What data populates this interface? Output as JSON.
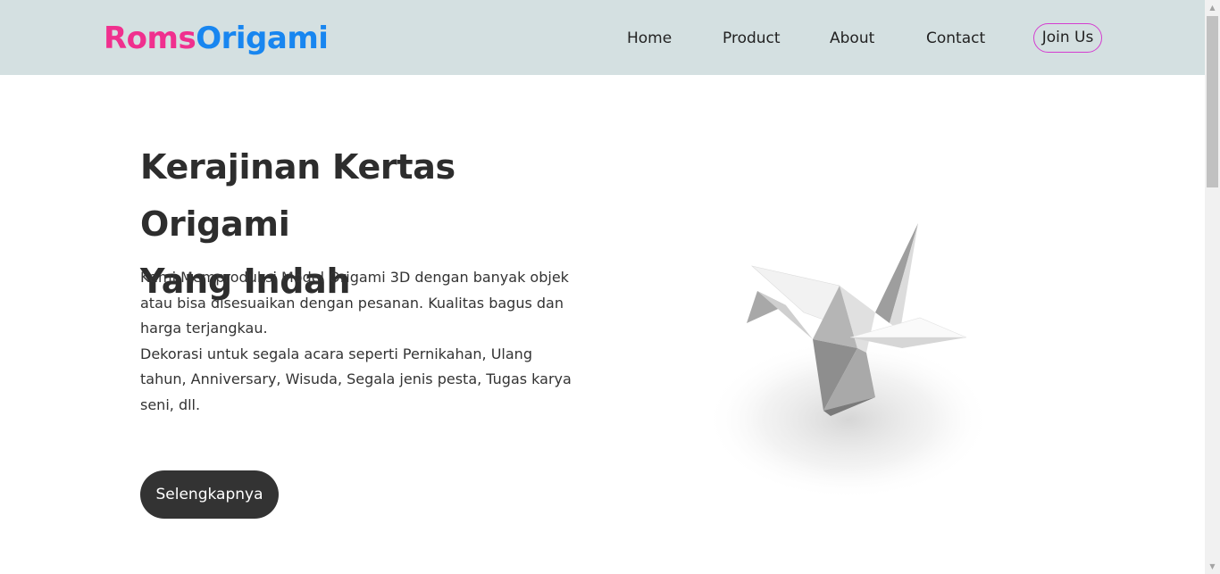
{
  "brand": {
    "part1": "Roms",
    "part2": "Origami",
    "color1": "#f0308e",
    "color2": "#1886f0"
  },
  "nav": {
    "home": "Home",
    "product": "Product",
    "about": "About",
    "contact": "Contact",
    "join": "Join Us"
  },
  "hero": {
    "title_line1": "Kerajinan Kertas Origami",
    "title_line2": "Yang Indah",
    "desc1": "Kami Memproduksi Model Origami 3D dengan banyak objek atau bisa disesuaikan dengan pesanan. Kualitas bagus dan harga terjangkau.",
    "desc2": "Dekorasi untuk segala acara seperti Pernikahan, Ulang tahun, Anniversary, Wisuda, Segala jenis pesta, Tugas karya seni, dll.",
    "cta": "Selengkapnya",
    "image": "origami-crane-image"
  },
  "colors": {
    "navbar_bg": "#d4e0e1",
    "cta_bg": "#333333",
    "join_border": "#d43dd0"
  }
}
